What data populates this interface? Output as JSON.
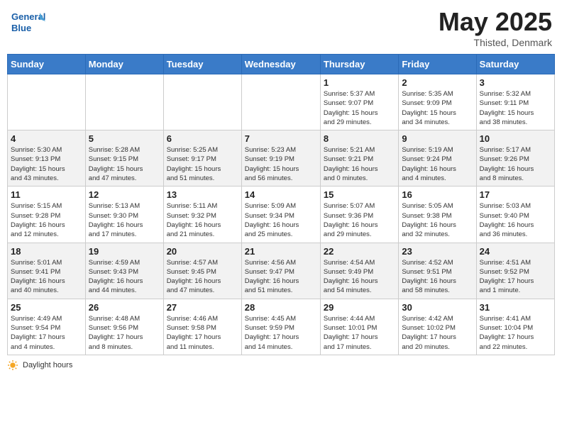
{
  "header": {
    "logo_general": "General",
    "logo_blue": "Blue",
    "title": "May 2025",
    "location": "Thisted, Denmark"
  },
  "days_of_week": [
    "Sunday",
    "Monday",
    "Tuesday",
    "Wednesday",
    "Thursday",
    "Friday",
    "Saturday"
  ],
  "weeks": [
    [
      {
        "day": "",
        "info": ""
      },
      {
        "day": "",
        "info": ""
      },
      {
        "day": "",
        "info": ""
      },
      {
        "day": "",
        "info": ""
      },
      {
        "day": "1",
        "info": "Sunrise: 5:37 AM\nSunset: 9:07 PM\nDaylight: 15 hours\nand 29 minutes."
      },
      {
        "day": "2",
        "info": "Sunrise: 5:35 AM\nSunset: 9:09 PM\nDaylight: 15 hours\nand 34 minutes."
      },
      {
        "day": "3",
        "info": "Sunrise: 5:32 AM\nSunset: 9:11 PM\nDaylight: 15 hours\nand 38 minutes."
      }
    ],
    [
      {
        "day": "4",
        "info": "Sunrise: 5:30 AM\nSunset: 9:13 PM\nDaylight: 15 hours\nand 43 minutes."
      },
      {
        "day": "5",
        "info": "Sunrise: 5:28 AM\nSunset: 9:15 PM\nDaylight: 15 hours\nand 47 minutes."
      },
      {
        "day": "6",
        "info": "Sunrise: 5:25 AM\nSunset: 9:17 PM\nDaylight: 15 hours\nand 51 minutes."
      },
      {
        "day": "7",
        "info": "Sunrise: 5:23 AM\nSunset: 9:19 PM\nDaylight: 15 hours\nand 56 minutes."
      },
      {
        "day": "8",
        "info": "Sunrise: 5:21 AM\nSunset: 9:21 PM\nDaylight: 16 hours\nand 0 minutes."
      },
      {
        "day": "9",
        "info": "Sunrise: 5:19 AM\nSunset: 9:24 PM\nDaylight: 16 hours\nand 4 minutes."
      },
      {
        "day": "10",
        "info": "Sunrise: 5:17 AM\nSunset: 9:26 PM\nDaylight: 16 hours\nand 8 minutes."
      }
    ],
    [
      {
        "day": "11",
        "info": "Sunrise: 5:15 AM\nSunset: 9:28 PM\nDaylight: 16 hours\nand 12 minutes."
      },
      {
        "day": "12",
        "info": "Sunrise: 5:13 AM\nSunset: 9:30 PM\nDaylight: 16 hours\nand 17 minutes."
      },
      {
        "day": "13",
        "info": "Sunrise: 5:11 AM\nSunset: 9:32 PM\nDaylight: 16 hours\nand 21 minutes."
      },
      {
        "day": "14",
        "info": "Sunrise: 5:09 AM\nSunset: 9:34 PM\nDaylight: 16 hours\nand 25 minutes."
      },
      {
        "day": "15",
        "info": "Sunrise: 5:07 AM\nSunset: 9:36 PM\nDaylight: 16 hours\nand 29 minutes."
      },
      {
        "day": "16",
        "info": "Sunrise: 5:05 AM\nSunset: 9:38 PM\nDaylight: 16 hours\nand 32 minutes."
      },
      {
        "day": "17",
        "info": "Sunrise: 5:03 AM\nSunset: 9:40 PM\nDaylight: 16 hours\nand 36 minutes."
      }
    ],
    [
      {
        "day": "18",
        "info": "Sunrise: 5:01 AM\nSunset: 9:41 PM\nDaylight: 16 hours\nand 40 minutes."
      },
      {
        "day": "19",
        "info": "Sunrise: 4:59 AM\nSunset: 9:43 PM\nDaylight: 16 hours\nand 44 minutes."
      },
      {
        "day": "20",
        "info": "Sunrise: 4:57 AM\nSunset: 9:45 PM\nDaylight: 16 hours\nand 47 minutes."
      },
      {
        "day": "21",
        "info": "Sunrise: 4:56 AM\nSunset: 9:47 PM\nDaylight: 16 hours\nand 51 minutes."
      },
      {
        "day": "22",
        "info": "Sunrise: 4:54 AM\nSunset: 9:49 PM\nDaylight: 16 hours\nand 54 minutes."
      },
      {
        "day": "23",
        "info": "Sunrise: 4:52 AM\nSunset: 9:51 PM\nDaylight: 16 hours\nand 58 minutes."
      },
      {
        "day": "24",
        "info": "Sunrise: 4:51 AM\nSunset: 9:52 PM\nDaylight: 17 hours\nand 1 minute."
      }
    ],
    [
      {
        "day": "25",
        "info": "Sunrise: 4:49 AM\nSunset: 9:54 PM\nDaylight: 17 hours\nand 4 minutes."
      },
      {
        "day": "26",
        "info": "Sunrise: 4:48 AM\nSunset: 9:56 PM\nDaylight: 17 hours\nand 8 minutes."
      },
      {
        "day": "27",
        "info": "Sunrise: 4:46 AM\nSunset: 9:58 PM\nDaylight: 17 hours\nand 11 minutes."
      },
      {
        "day": "28",
        "info": "Sunrise: 4:45 AM\nSunset: 9:59 PM\nDaylight: 17 hours\nand 14 minutes."
      },
      {
        "day": "29",
        "info": "Sunrise: 4:44 AM\nSunset: 10:01 PM\nDaylight: 17 hours\nand 17 minutes."
      },
      {
        "day": "30",
        "info": "Sunrise: 4:42 AM\nSunset: 10:02 PM\nDaylight: 17 hours\nand 20 minutes."
      },
      {
        "day": "31",
        "info": "Sunrise: 4:41 AM\nSunset: 10:04 PM\nDaylight: 17 hours\nand 22 minutes."
      }
    ]
  ],
  "footer": {
    "daylight_label": "Daylight hours"
  }
}
